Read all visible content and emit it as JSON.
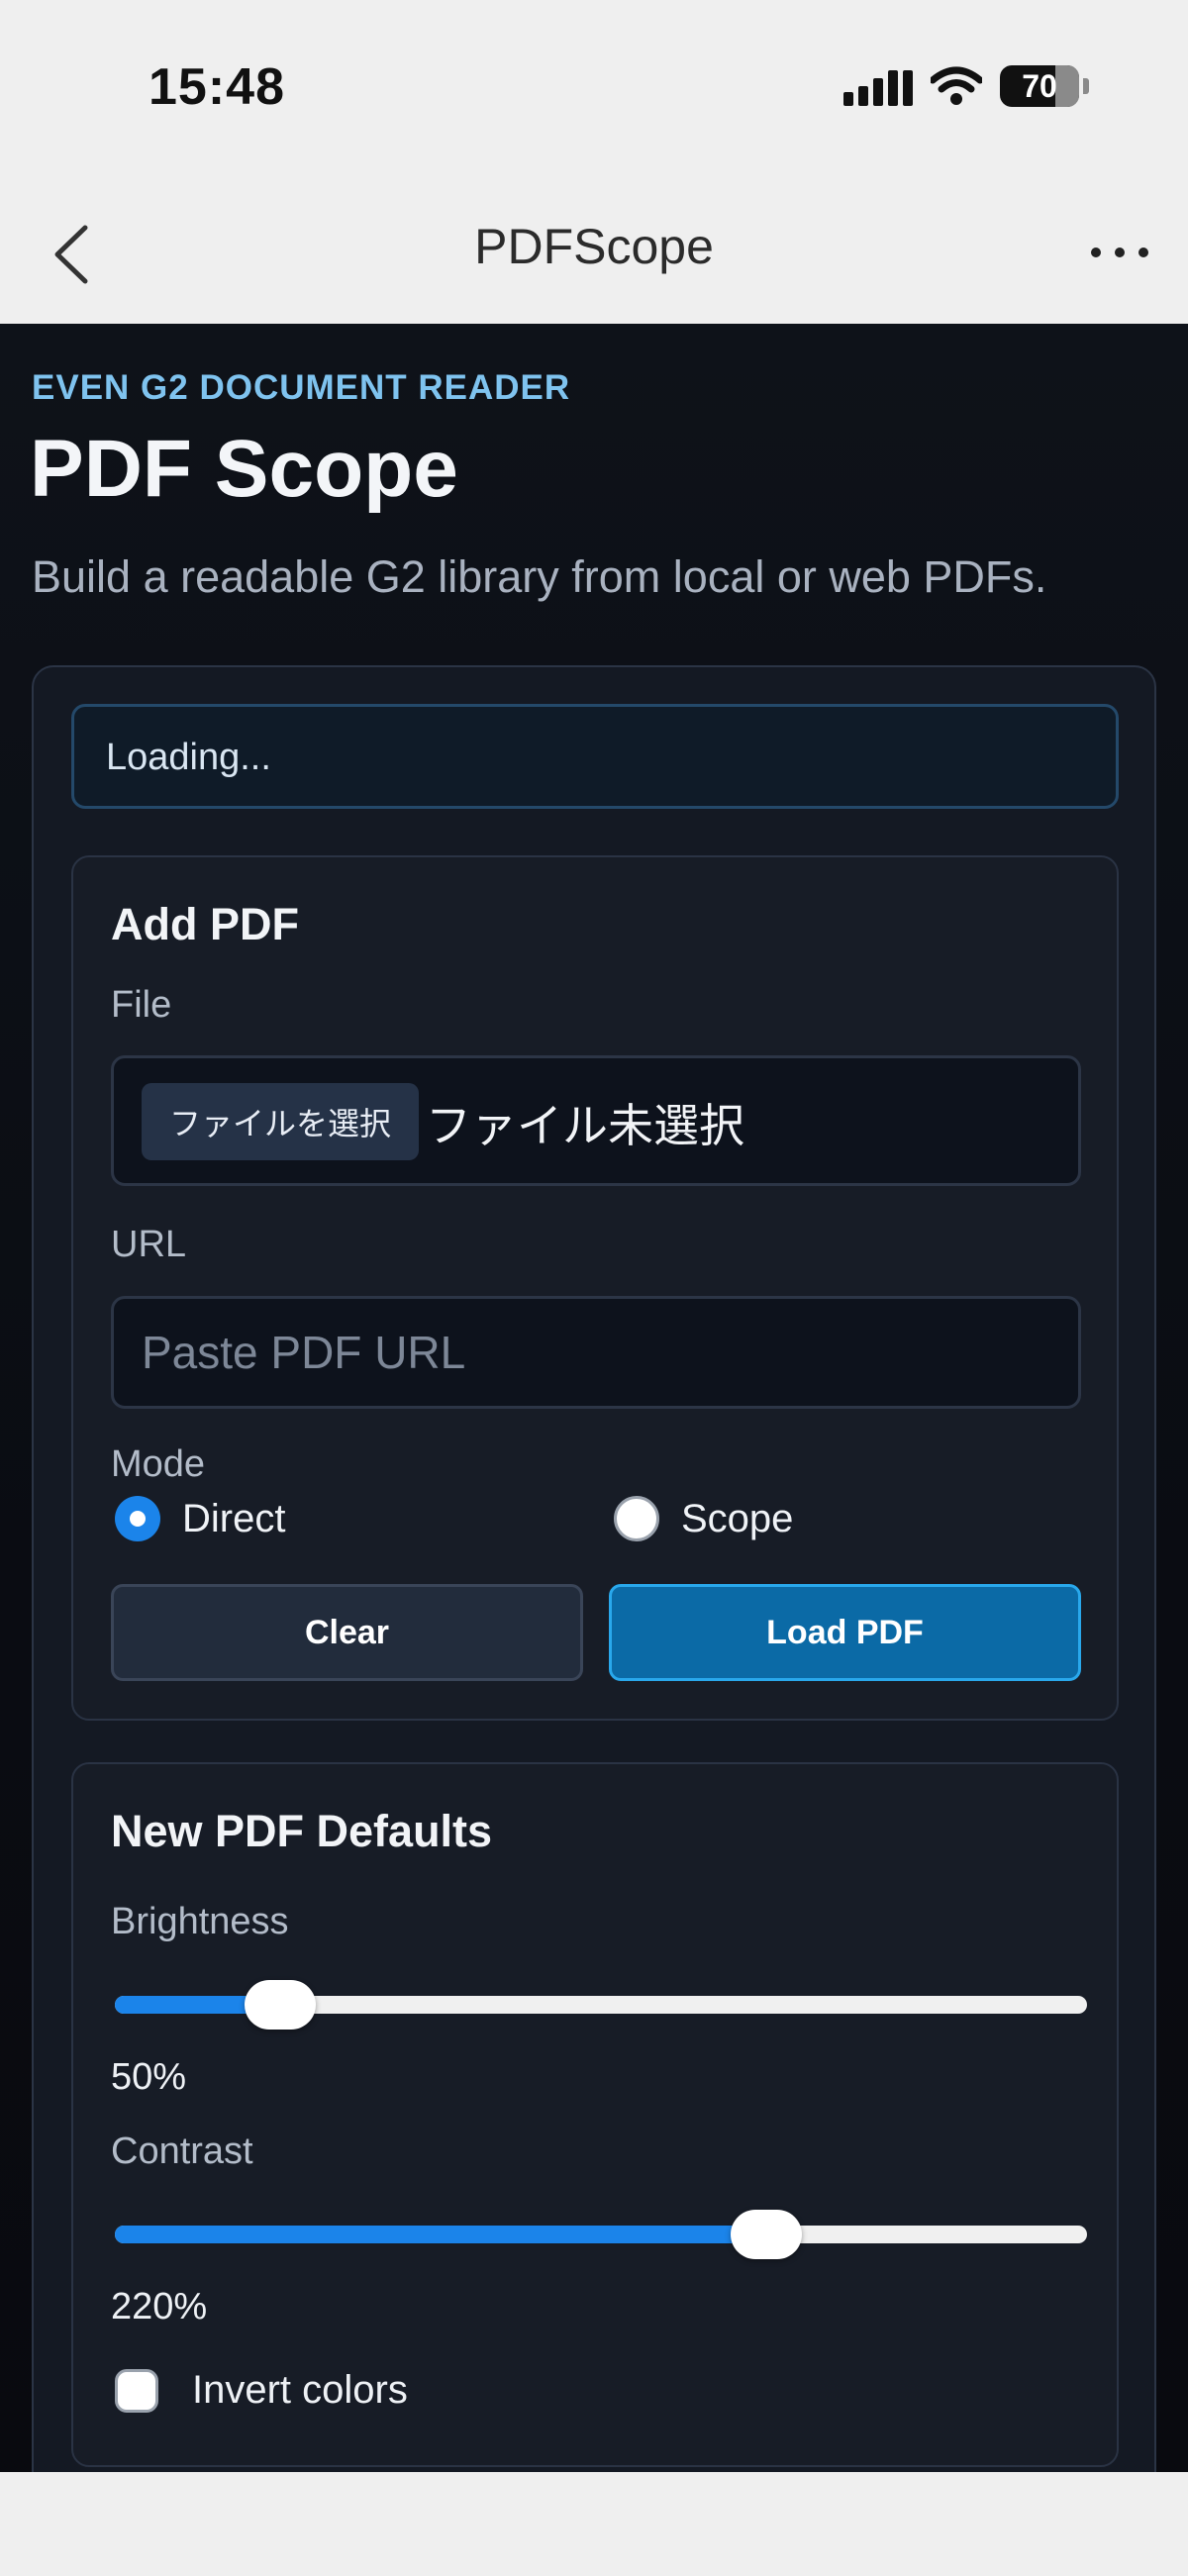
{
  "status_bar": {
    "time": "15:48",
    "battery_percent": "70",
    "battery_level": 0.7,
    "icons": [
      "signal-icon",
      "wifi-icon",
      "battery-icon"
    ]
  },
  "nav": {
    "title": "PDFScope",
    "back_icon": "chevron-left-icon",
    "more_icon": "more-horizontal-icon"
  },
  "app": {
    "eyebrow": "EVEN G2 DOCUMENT READER",
    "title": "PDF Scope",
    "subtitle": "Build a readable G2 library from local or web PDFs.",
    "status": "Loading..."
  },
  "add_pdf": {
    "heading": "Add PDF",
    "file_label": "File",
    "file_button": "ファイルを選択",
    "file_status": "ファイル未選択",
    "url_label": "URL",
    "url_placeholder": "Paste PDF URL",
    "url_value": "",
    "mode_label": "Mode",
    "modes": [
      {
        "label": "Direct",
        "selected": true
      },
      {
        "label": "Scope",
        "selected": false
      }
    ],
    "clear_label": "Clear",
    "load_label": "Load PDF"
  },
  "defaults": {
    "heading": "New PDF Defaults",
    "brightness_label": "Brightness",
    "brightness_value": "50%",
    "brightness_fraction": 0.17,
    "contrast_label": "Contrast",
    "contrast_value": "220%",
    "contrast_fraction": 0.67,
    "invert_label": "Invert colors",
    "invert_checked": false
  },
  "colors": {
    "accent": "#1b84ea",
    "primary_button": "#0b6aa6",
    "eyebrow": "#7fc3ef",
    "background": "#0a0c12"
  }
}
